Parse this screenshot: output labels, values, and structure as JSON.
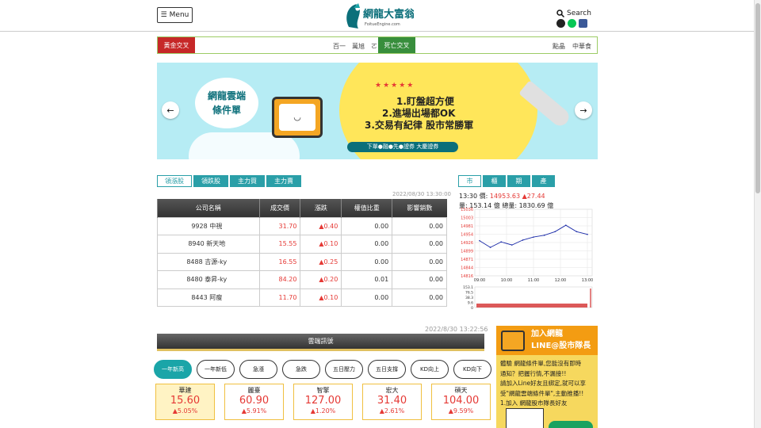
{
  "header": {
    "menu_label": "Menu",
    "logo_text": "網龍大富翁",
    "logo_sub": "FoitueEngine.com",
    "search_label": "Search"
  },
  "ticker": {
    "golden_label": "黃金交叉",
    "golden_items": [
      "百一",
      "萬旭",
      "ㄛ"
    ],
    "death_label": "死亡交叉",
    "death_items": [
      "點晶",
      "中華食"
    ]
  },
  "banner": {
    "bubble_line1": "網龍雲端",
    "bubble_line2": "條件單",
    "stars": "★★★★★",
    "point1": "1.盯盤超方便",
    "point2": "2.進場出場都OK",
    "point3": "3.交易有紀律 股市常勝軍",
    "strip": "下單●融●先●證券 大慶證券",
    "prev_label": "←",
    "next_label": "→"
  },
  "stock_tabs": [
    {
      "label": "領漲股",
      "active": true
    },
    {
      "label": "領跌股",
      "active": false
    },
    {
      "label": "主力買",
      "active": false
    },
    {
      "label": "主力賣",
      "active": false
    }
  ],
  "stock_table": {
    "timestamp": "2022/08/30 13:30:00",
    "columns": [
      "公司名稱",
      "成交價",
      "漲跌",
      "權值比重",
      "影響銷數"
    ],
    "rows": [
      {
        "name": "9928 中視",
        "price": "31.70",
        "change": "▲0.40",
        "weight": "0.00",
        "impact": "0.00"
      },
      {
        "name": "8940 新天地",
        "price": "15.55",
        "change": "▲0.10",
        "weight": "0.00",
        "impact": "0.00"
      },
      {
        "name": "8488 吉源-ky",
        "price": "16.55",
        "change": "▲0.25",
        "weight": "0.00",
        "impact": "0.00"
      },
      {
        "name": "8480 泰昇-ky",
        "price": "84.20",
        "change": "▲0.20",
        "weight": "0.01",
        "impact": "0.00"
      },
      {
        "name": "8443 阿瘦",
        "price": "11.70",
        "change": "▲0.10",
        "weight": "0.00",
        "impact": "0.00"
      }
    ]
  },
  "market_tabs": [
    {
      "label": "市",
      "active": true
    },
    {
      "label": "櫃",
      "active": false
    },
    {
      "label": "期",
      "active": false
    },
    {
      "label": "產",
      "active": false
    }
  ],
  "market_info": {
    "time": "13:30",
    "price_label": "價:",
    "price": "14953.63",
    "change": "▲27.44",
    "volume": "量: 153.14 億",
    "total": "總量: 1830.69 億"
  },
  "chart_data": {
    "type": "line",
    "x": [
      "09:00",
      "09:30",
      "10:00",
      "10:30",
      "11:00",
      "11:30",
      "12:00",
      "12:30",
      "13:00",
      "13:20",
      "13:30"
    ],
    "values": [
      14932,
      14910,
      14928,
      14918,
      14934,
      14944,
      14950,
      14962,
      14983,
      14962,
      14953
    ],
    "ylim": [
      14816,
      15036
    ],
    "yticks": [
      "15036",
      "15003",
      "14981",
      "14954",
      "14926",
      "14899",
      "14871",
      "14844",
      "14816"
    ],
    "xticks": [
      "09:00",
      "10:00",
      "11:00",
      "12:00",
      "13:00"
    ],
    "volume_ticks": [
      "153.1",
      "76.5",
      "38.3",
      "9.6",
      "0"
    ],
    "line_color": "#1a2aa8",
    "volume_color": "#d32f2f"
  },
  "signals": {
    "timestamp": "2022/8/30 13:22:56",
    "title": "雲端訊號",
    "pills": [
      {
        "label": "一年新高",
        "active": true
      },
      {
        "label": "一年新低",
        "active": false
      },
      {
        "label": "急漲",
        "active": false
      },
      {
        "label": "急跌",
        "active": false
      },
      {
        "label": "五日壓力",
        "active": false
      },
      {
        "label": "五日支撐",
        "active": false
      },
      {
        "label": "KD向上",
        "active": false
      },
      {
        "label": "KD向下",
        "active": false
      }
    ],
    "cards": [
      {
        "name": "華建",
        "price": "15.60",
        "change": "▲5.05%"
      },
      {
        "name": "麗臺",
        "price": "60.90",
        "change": "▲5.91%"
      },
      {
        "name": "智擎",
        "price": "127.00",
        "change": "▲1.20%"
      },
      {
        "name": "宏大",
        "price": "31.40",
        "change": "▲2.61%"
      },
      {
        "name": "碩天",
        "price": "104.00",
        "change": "▲9.59%"
      }
    ]
  },
  "line_ad": {
    "title1": "加入網龍",
    "title2": "LINE@股市隊長",
    "body": [
      "體驗 網龍條件單,您能沒有即時",
      "通知？把握行情,不漏接!!",
      "請加入Line好友且綁定,就可以享",
      "受\"網龍雲端條件單\",主動推播!!",
      "1.加入 網龍股市隊長好友"
    ]
  }
}
